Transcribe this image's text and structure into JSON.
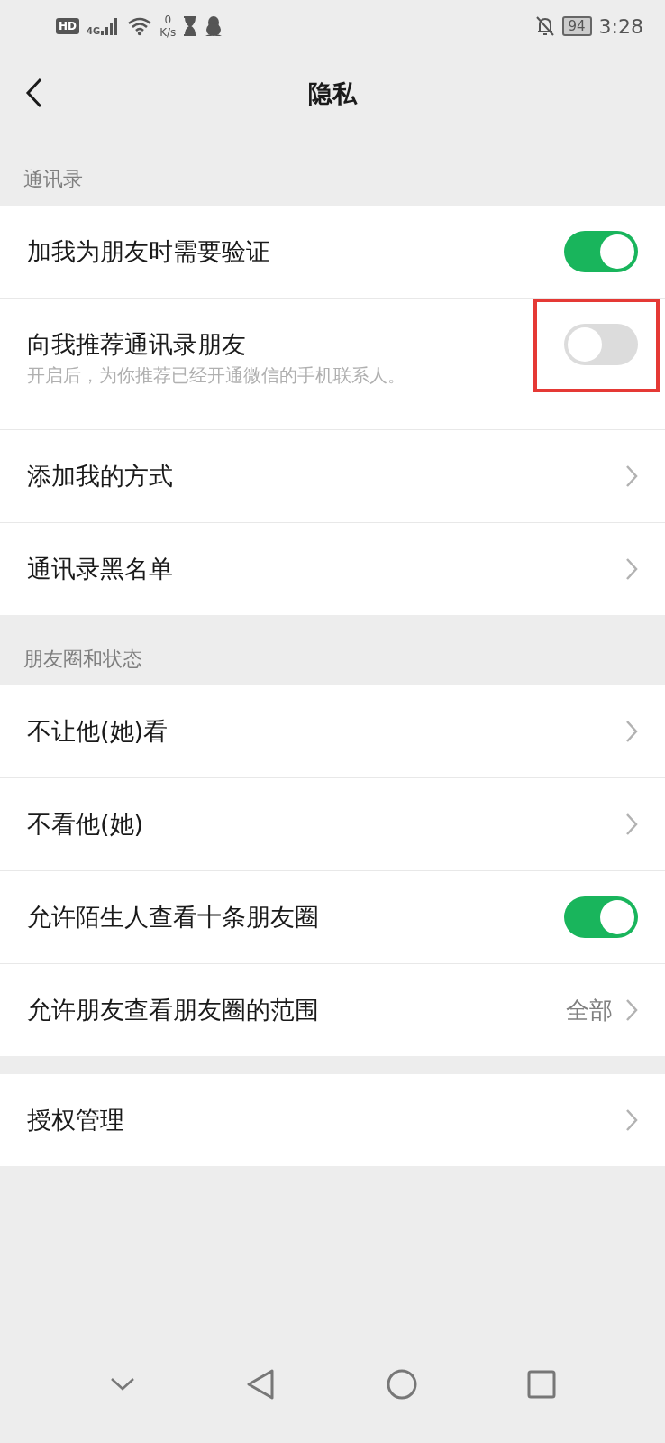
{
  "status_bar": {
    "hd": "HD",
    "network": "4G",
    "speed_value": "0",
    "speed_unit": "K/s",
    "battery": "94",
    "time": "3:28"
  },
  "header": {
    "title": "隐私"
  },
  "sections": [
    {
      "label": "通讯录",
      "rows": [
        {
          "kind": "toggle",
          "label": "加我为朋友时需要验证",
          "on": true
        },
        {
          "kind": "toggle",
          "label": "向我推荐通讯录朋友",
          "on": false,
          "description": "开启后，为你推荐已经开通微信的手机联系人。",
          "highlighted": true
        },
        {
          "kind": "link",
          "label": "添加我的方式"
        },
        {
          "kind": "link",
          "label": "通讯录黑名单"
        }
      ]
    },
    {
      "label": "朋友圈和状态",
      "rows": [
        {
          "kind": "link",
          "label": "不让他(她)看"
        },
        {
          "kind": "link",
          "label": "不看他(她)"
        },
        {
          "kind": "toggle",
          "label": "允许陌生人查看十条朋友圈",
          "on": true
        },
        {
          "kind": "link",
          "label": "允许朋友查看朋友圈的范围",
          "value": "全部"
        }
      ]
    },
    {
      "rows": [
        {
          "kind": "link",
          "label": "授权管理"
        }
      ]
    }
  ]
}
